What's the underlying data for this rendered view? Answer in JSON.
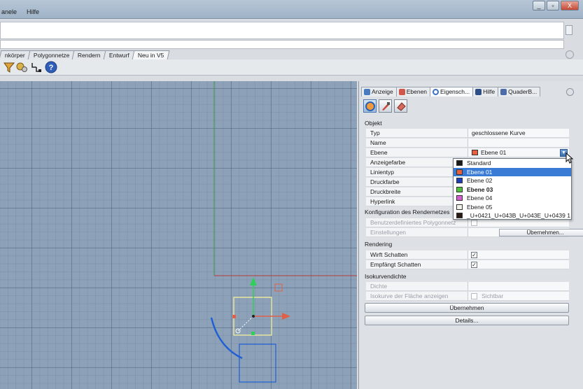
{
  "window": {
    "menu": [
      "anele",
      "Hilfe"
    ],
    "buttons": [
      "_",
      "▫",
      "X"
    ]
  },
  "toolbar_tabs": [
    {
      "label": "nkörper",
      "active": false
    },
    {
      "label": "Polygonnetze",
      "active": false
    },
    {
      "label": "Rendern",
      "active": false
    },
    {
      "label": "Entwurf",
      "active": false
    },
    {
      "label": "Neu in V5",
      "active": true
    }
  ],
  "panel": {
    "tabs": [
      {
        "label": "Anzeige",
        "icon": "monitor-icon",
        "active": false
      },
      {
        "label": "Ebenen",
        "icon": "layers-icon",
        "active": false
      },
      {
        "label": "Eigensch...",
        "icon": "properties-icon",
        "active": true
      },
      {
        "label": "Hilfe",
        "icon": "help-icon",
        "active": false
      },
      {
        "label": "QuaderB...",
        "icon": "box-icon",
        "active": false
      }
    ],
    "sections": {
      "object": "Objekt",
      "mesh": "Konfiguration des Rendernetzes",
      "rendering": "Rendering",
      "iso": "Isokurvendichte"
    },
    "rows": {
      "typ": {
        "label": "Typ",
        "value": "geschlossene Kurve"
      },
      "name": {
        "label": "Name",
        "value": ""
      },
      "ebene": {
        "label": "Ebene",
        "value": "Ebene 01",
        "color": "#e8603c"
      },
      "anzeigefarbe": {
        "label": "Anzeigefarbe"
      },
      "linientyp": {
        "label": "Linientyp"
      },
      "druckfarbe": {
        "label": "Druckfarbe"
      },
      "druckbreite": {
        "label": "Druckbreite"
      },
      "hyperlink": {
        "label": "Hyperlink"
      },
      "benutzer": {
        "label": "Benutzerdefiniertes Polygonnetz"
      },
      "einstellungen": {
        "label": "Einstellungen",
        "button": "Übernehmen..."
      },
      "wirft": {
        "label": "Wirft Schatten",
        "checked": true
      },
      "empfaengt": {
        "label": "Empfängt Schatten",
        "checked": true
      },
      "dichte": {
        "label": "Dichte"
      },
      "isokurve": {
        "label": "Isokurve der Fläche anzeigen",
        "checkbox_label": "Sichtbar",
        "checked": false
      }
    },
    "buttons": {
      "apply": "Übernehmen",
      "details": "Details..."
    }
  },
  "layer_dropdown": [
    {
      "label": "Standard",
      "color": "#1a1a1a",
      "selected": false,
      "bold": false
    },
    {
      "label": "Ebene 01",
      "color": "#e8603c",
      "selected": true,
      "bold": false
    },
    {
      "label": "Ebene 02",
      "color": "#1b3fb8",
      "selected": false,
      "bold": false
    },
    {
      "label": "Ebene 03",
      "color": "#4fc23a",
      "selected": false,
      "bold": true
    },
    {
      "label": "Ebene 04",
      "color": "#d35ed0",
      "selected": false,
      "bold": false
    },
    {
      "label": "Ebene 05",
      "color": "#f4f1ea",
      "selected": false,
      "bold": false
    },
    {
      "label": "_U+0421_U+043B_U+043E_U+0439 1",
      "color": "#2a1a14",
      "selected": false,
      "bold": false
    }
  ]
}
